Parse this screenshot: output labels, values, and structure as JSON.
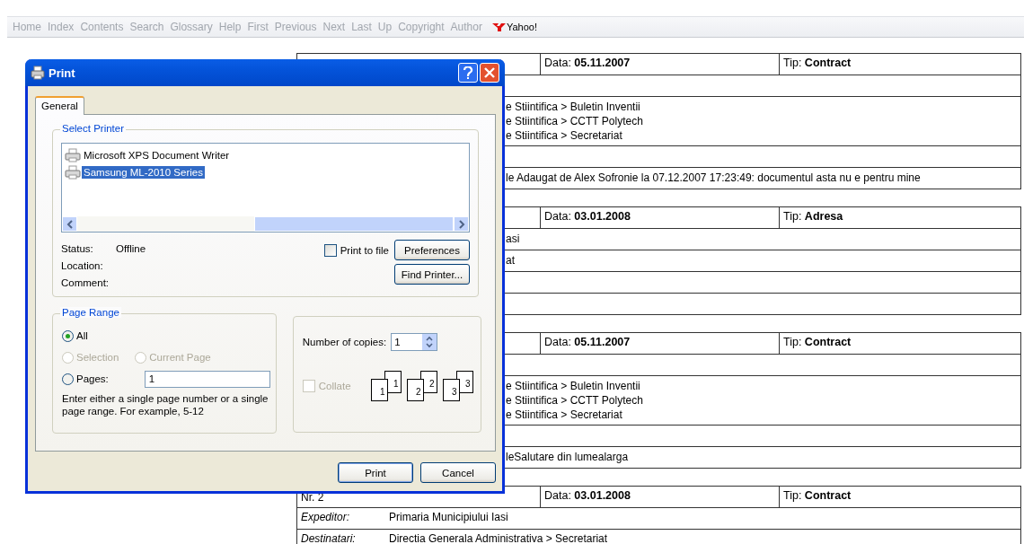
{
  "nav": {
    "links": [
      "Home",
      "Index",
      "Contents",
      "Search",
      "Glossary",
      "Help",
      "First",
      "Previous",
      "Next",
      "Last",
      "Up",
      "Copyright",
      "Author"
    ],
    "yahoo": "Yahoo!"
  },
  "records": [
    {
      "data_label": "Data:",
      "date": "05.11.2007",
      "tip_label": "Tip:",
      "tip": "Contract",
      "rows": [
        {
          "kind": "empty"
        },
        {
          "kind": "text",
          "lines": [
            "e Stiintifica > Buletin Inventii",
            "e Stiintifica > CCTT Polytech",
            "e Stiintifica > Secretariat"
          ]
        },
        {
          "kind": "empty"
        },
        {
          "kind": "text",
          "lines": [
            "le Adaugat de Alex Sofronie la 07.12.2007 17:23:49: documentul asta nu e pentru mine"
          ]
        }
      ]
    },
    {
      "data_label": "Data:",
      "date": "03.01.2008",
      "tip_label": "Tip:",
      "tip": "Adresa",
      "rows": [
        {
          "kind": "text",
          "lines": [
            "asi"
          ]
        },
        {
          "kind": "text",
          "lines": [
            "at"
          ]
        },
        {
          "kind": "empty"
        },
        {
          "kind": "empty"
        }
      ]
    },
    {
      "data_label": "Data:",
      "date": "05.11.2007",
      "tip_label": "Tip:",
      "tip": "Contract",
      "rows": [
        {
          "kind": "empty"
        },
        {
          "kind": "text",
          "lines": [
            "e Stiintifica > Buletin Inventii",
            "e Stiintifica > CCTT Polytech",
            "e Stiintifica > Secretariat"
          ]
        },
        {
          "kind": "empty"
        },
        {
          "kind": "text",
          "lines": [
            "leSalutare din lumealarga"
          ]
        }
      ]
    },
    {
      "nr": "Nr. 2",
      "data_label": "Data:",
      "date": "03.01.2008",
      "tip_label": "Tip:",
      "tip": "Contract",
      "rows": [
        {
          "kind": "field",
          "label": "Expeditor:",
          "value": "Primaria Municipiului Iasi"
        },
        {
          "kind": "field",
          "label": "Destinatari:",
          "value": "Directia Generala Administrativa > Secretariat"
        }
      ]
    }
  ],
  "print_dialog": {
    "title": "Print",
    "tabs": [
      {
        "label": "General",
        "selected": true
      }
    ],
    "select_printer": {
      "legend": "Select Printer",
      "printers": [
        {
          "name": "Microsoft XPS Document Writer",
          "selected": false
        },
        {
          "name": "Samsung ML-2010 Series",
          "selected": true
        }
      ],
      "status_label": "Status:",
      "status": "Offline",
      "location_label": "Location:",
      "comment_label": "Comment:",
      "print_to_file": {
        "label": "Print to file",
        "checked": false
      },
      "preferences": "Preferences",
      "find_printer": "Find Printer..."
    },
    "page_range": {
      "legend": "Page Range",
      "rows": [
        [
          {
            "label": "All",
            "selected": true,
            "disabled": false
          }
        ],
        [
          {
            "label": "Selection",
            "selected": false,
            "disabled": true
          },
          {
            "label": "Current Page",
            "selected": false,
            "disabled": true
          }
        ],
        [
          {
            "label": "Pages:",
            "selected": false,
            "disabled": false
          }
        ]
      ],
      "pages_value": "1",
      "hint": "Enter either a single page number or a single page range.  For example, 5-12"
    },
    "copies": {
      "label": "Number of copies:",
      "value": "1",
      "collate": {
        "label": "Collate",
        "checked": false,
        "disabled": true
      },
      "collate_sets": [
        {
          "back": "1",
          "front": "1"
        },
        {
          "back": "2",
          "front": "2"
        },
        {
          "back": "3",
          "front": "3"
        }
      ]
    },
    "buttons": [
      {
        "label": "Print",
        "default": true
      },
      {
        "label": "Cancel",
        "default": false
      }
    ]
  }
}
